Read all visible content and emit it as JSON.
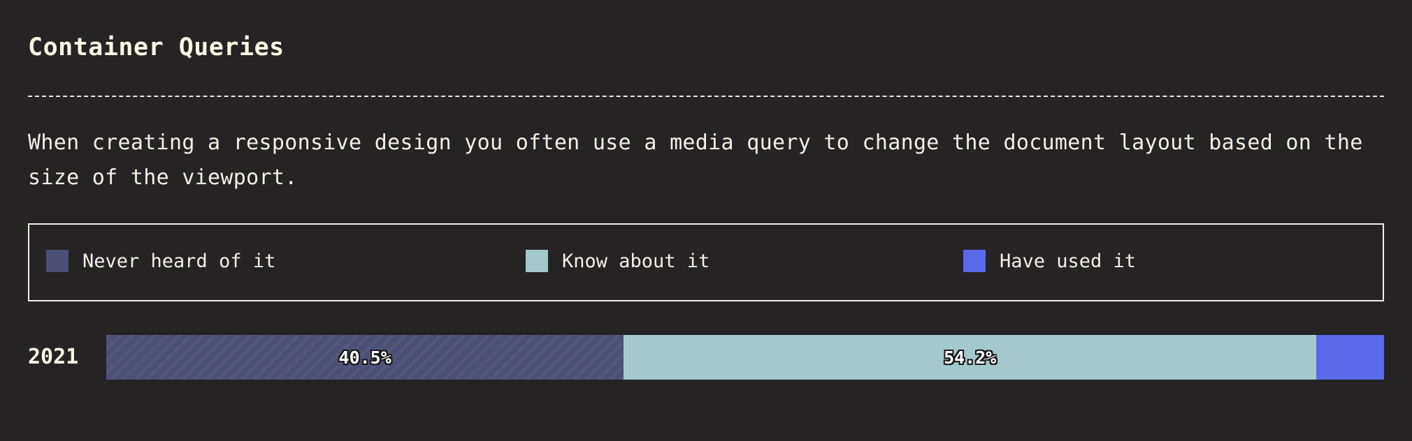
{
  "section": {
    "title": "Container Queries",
    "description": "When creating a responsive design you often use a media query to change the document layout based on the size of the viewport."
  },
  "legend": {
    "items": [
      {
        "label": "Never heard of it",
        "color": "#4c4f76"
      },
      {
        "label": "Know about it",
        "color": "#a3c9cd"
      },
      {
        "label": "Have used it",
        "color": "#5a6aea"
      }
    ]
  },
  "chart_data": {
    "type": "bar",
    "orientation": "horizontal",
    "stacked": true,
    "normalized": true,
    "categories": [
      "2021"
    ],
    "series": [
      {
        "name": "Never heard of it",
        "values": [
          40.5
        ],
        "color": "#4c4f76",
        "label": "40.5%"
      },
      {
        "name": "Know about it",
        "values": [
          54.2
        ],
        "color": "#a3c9cd",
        "label": "54.2%"
      },
      {
        "name": "Have used it",
        "values": [
          5.3
        ],
        "color": "#5a6aea",
        "label": ""
      }
    ],
    "xlim": [
      0,
      100
    ],
    "legend_position": "top"
  }
}
